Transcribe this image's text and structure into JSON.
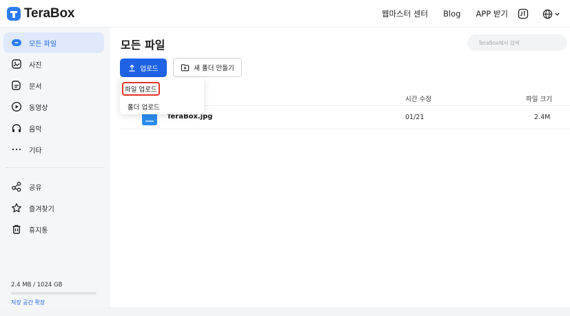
{
  "app": {
    "name": "TeraBox"
  },
  "topnav": {
    "webmaster": "웹마스터 센터",
    "blog": "Blog",
    "app": "APP 받기"
  },
  "sidebar": {
    "items": [
      {
        "label": "모든 파일",
        "icon": "all-files-icon",
        "active": true
      },
      {
        "label": "사진",
        "icon": "photo-icon"
      },
      {
        "label": "문서",
        "icon": "document-icon"
      },
      {
        "label": "동영상",
        "icon": "video-icon"
      },
      {
        "label": "음악",
        "icon": "music-icon"
      },
      {
        "label": "기타",
        "icon": "more-icon"
      },
      {
        "label": "공유",
        "icon": "share-icon"
      },
      {
        "label": "즐겨찾기",
        "icon": "star-icon"
      },
      {
        "label": "휴지통",
        "icon": "trash-icon"
      }
    ],
    "storage": {
      "text": "2.4 MB / 1024 GB",
      "used_fraction": 0.0
    },
    "expand": "저장 공간 확장"
  },
  "main": {
    "title": "모든 파일",
    "search_placeholder": "TeraBox에서 검색",
    "upload_label": "업로드",
    "new_folder_label": "새 폴더 만들기",
    "dropdown": {
      "file_upload": "파일 업로드",
      "folder_upload": "폴더 업로드"
    },
    "table": {
      "headers": {
        "time": "시간 수정",
        "size": "파일 크기"
      },
      "rows": [
        {
          "name": "TeraBox.jpg",
          "time": "01/21",
          "size": "2.4M"
        }
      ]
    }
  },
  "colors": {
    "accent": "#1f62e6",
    "highlight_border": "#e03526",
    "sidebar_bg": "#f5f6f8"
  }
}
